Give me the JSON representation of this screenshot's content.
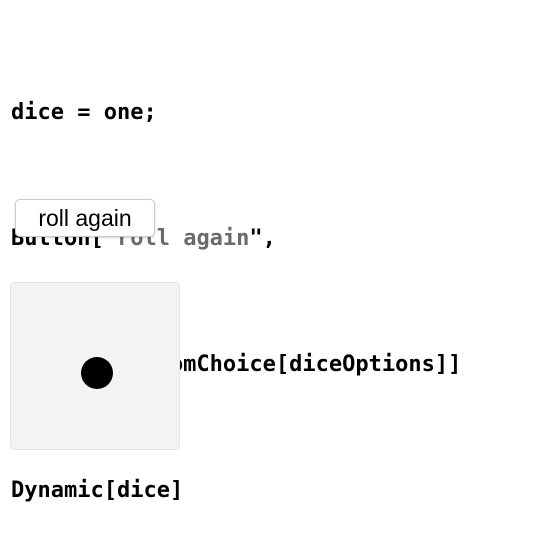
{
  "notebook": {
    "code_lines": [
      {
        "segments": [
          {
            "text": "dice = one;",
            "style": "plain"
          }
        ]
      },
      {
        "segments": [
          {
            "text": "Button[\"",
            "style": "plain"
          },
          {
            "text": "roll again",
            "style": "string"
          },
          {
            "text": "\",",
            "style": "plain"
          }
        ]
      },
      {
        "segments": [
          {
            "text": " dice = RandomChoice[diceOptions]]",
            "style": "plain"
          }
        ]
      },
      {
        "segments": [
          {
            "text": "Dynamic[dice]",
            "style": "plain"
          }
        ]
      }
    ]
  },
  "output": {
    "button_label": "roll again",
    "dice": {
      "face_value": 1,
      "face_color": "#f3f3f3",
      "pip_color": "#000000"
    }
  },
  "colors": {
    "code_text": "#000000",
    "string_literal": "#6b6b6b",
    "background": "#ffffff"
  }
}
